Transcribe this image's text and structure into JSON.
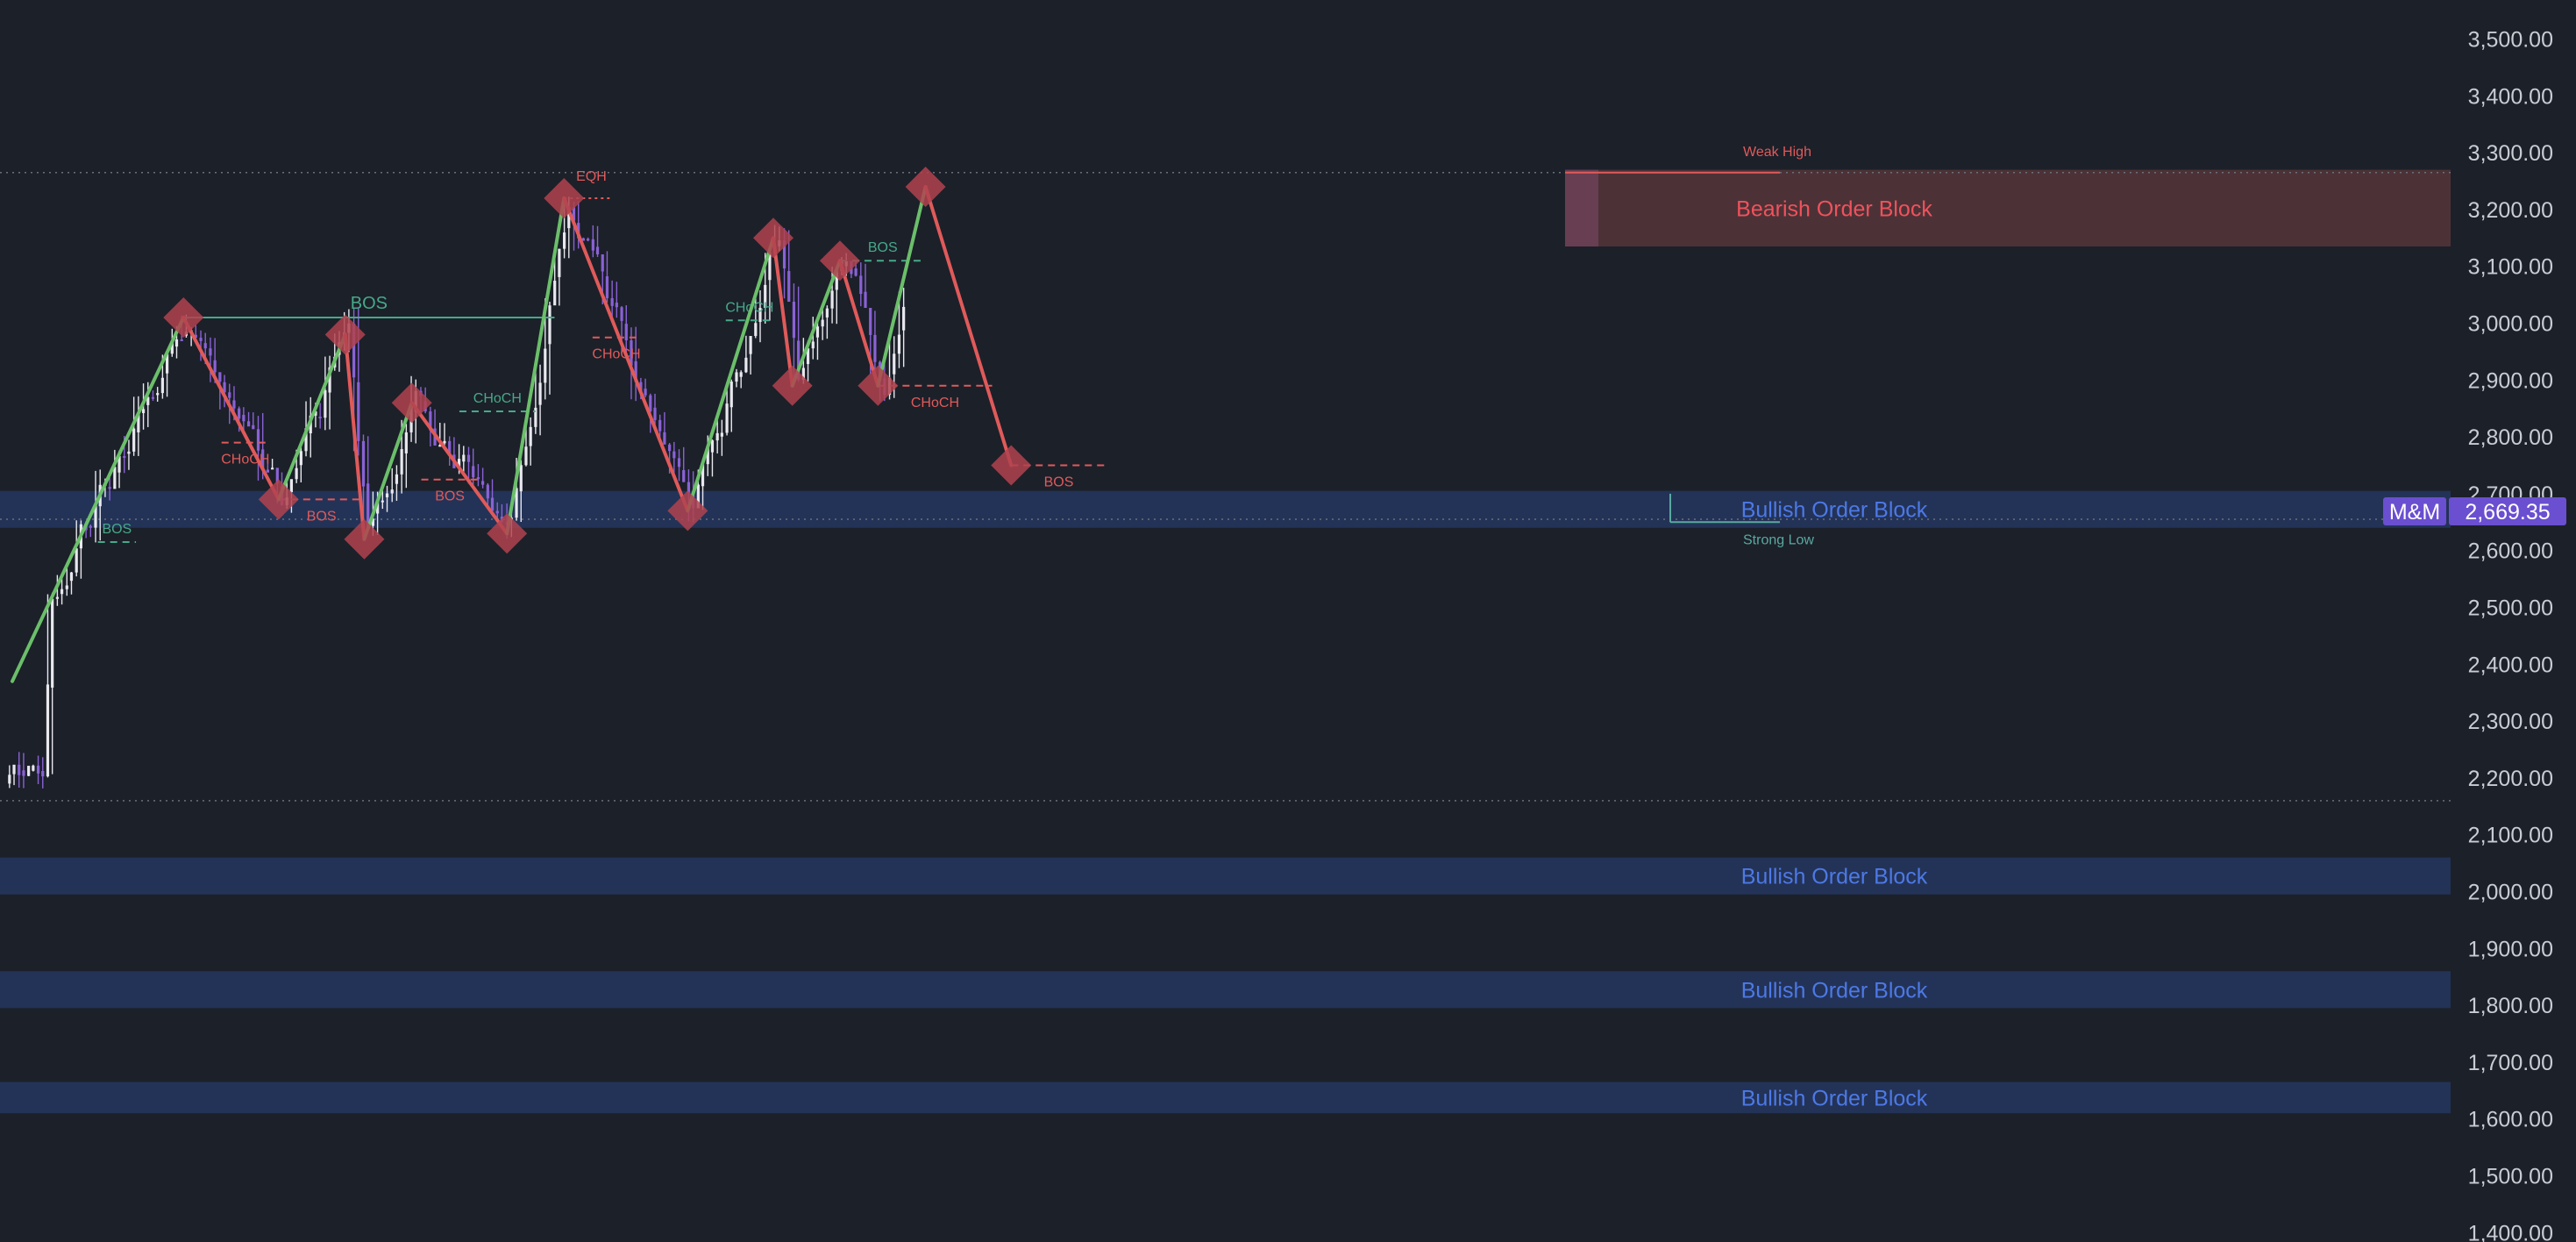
{
  "chart_data": {
    "type": "candlestick",
    "title": "",
    "ylim": [
      1400,
      3560
    ],
    "y_ticks": [
      "3,500.00",
      "3,400.00",
      "3,300.00",
      "3,200.00",
      "3,100.00",
      "3,000.00",
      "2,900.00",
      "2,800.00",
      "2,700.00",
      "2,600.00",
      "2,500.00",
      "2,400.00",
      "2,300.00",
      "2,200.00",
      "2,100.00",
      "2,000.00",
      "1,900.00",
      "1,800.00",
      "1,700.00",
      "1,600.00",
      "1,500.00",
      "1,400.00"
    ],
    "tick_values": [
      3500,
      3400,
      3300,
      3200,
      3100,
      3000,
      2900,
      2800,
      2700,
      2600,
      2500,
      2400,
      2300,
      2200,
      2100,
      2000,
      1900,
      1800,
      1700,
      1600,
      1500,
      1400
    ],
    "x_ticks": [],
    "grid": false,
    "legend": "none",
    "bars": 178,
    "last_price": 2669.35,
    "last_price_label": "2,669.35",
    "tag_label": "M&M",
    "colors": {
      "background": "#1c2029",
      "up_candle": "#e8e8ee",
      "down_candle": "#8a62d6",
      "bullish_line": "#6bbf6a",
      "bearish_line": "#e05a5a",
      "pivot_diamond": "#b0434f",
      "bos_bull": "#46a98a",
      "bos_bear": "#e05a5a",
      "order_block_bull": "#25355c",
      "order_block_bull_text": "#4d79e6",
      "order_block_bear": "#4f3438",
      "order_block_bear_text": "#f0525c",
      "price_tag": "#6a4fd0"
    },
    "zigzag": [
      {
        "i": 0,
        "price": 2370
      },
      {
        "i": 18,
        "price": 3010
      },
      {
        "i": 28,
        "price": 2690
      },
      {
        "i": 35,
        "price": 2980
      },
      {
        "i": 37,
        "price": 2620
      },
      {
        "i": 42,
        "price": 2860
      },
      {
        "i": 52,
        "price": 2630
      },
      {
        "i": 58,
        "price": 3220
      },
      {
        "i": 71,
        "price": 2670
      },
      {
        "i": 80,
        "price": 3150
      },
      {
        "i": 82,
        "price": 2890
      },
      {
        "i": 87,
        "price": 3110
      },
      {
        "i": 91,
        "price": 2890
      },
      {
        "i": 96,
        "price": 3240
      },
      {
        "i": 105,
        "price": 2750
      }
    ],
    "structure_labels": [
      {
        "text": "BOS",
        "i1": 18,
        "i2": 57,
        "price": 3010,
        "side": "bull",
        "size": "md"
      },
      {
        "text": "BOS",
        "i1": 9,
        "i2": 13,
        "price": 2615,
        "side": "bull",
        "size": "sm"
      },
      {
        "text": "CHoCH",
        "i1": 22,
        "i2": 27,
        "price": 2790,
        "side": "bear",
        "size": "sm"
      },
      {
        "text": "BOS",
        "i1": 28,
        "i2": 37,
        "price": 2690,
        "side": "bear",
        "size": "sm"
      },
      {
        "text": "BOS",
        "i1": 43,
        "i2": 49,
        "price": 2725,
        "side": "bear",
        "size": "sm"
      },
      {
        "text": "CHoCH",
        "i1": 47,
        "i2": 55,
        "price": 2845,
        "side": "bull",
        "size": "sm"
      },
      {
        "text": "CHoCH",
        "i1": 61,
        "i2": 66,
        "price": 2975,
        "side": "bear",
        "size": "sm"
      },
      {
        "text": "CHoCH",
        "i1": 75,
        "i2": 80,
        "price": 3005,
        "side": "bull",
        "size": "sm"
      },
      {
        "text": "BOS",
        "i1": 87,
        "i2": 96,
        "price": 3110,
        "side": "bull",
        "size": "sm"
      },
      {
        "text": "CHoCH",
        "i1": 91,
        "i2": 103,
        "price": 2890,
        "side": "bear",
        "size": "sm"
      },
      {
        "text": "BOS",
        "i1": 105,
        "i2": 115,
        "price": 2750,
        "side": "bear",
        "size": "sm"
      }
    ],
    "eqh": {
      "text": "EQH",
      "i1": 58,
      "i2": 63,
      "price": 3220
    },
    "order_blocks": [
      {
        "label": "Bearish Order Block",
        "low": 3135,
        "high": 3270,
        "side": "bear",
        "from_i": 110
      },
      {
        "label": "Bullish Order Block",
        "low": 2640,
        "high": 2705,
        "side": "bull",
        "from_i": 0
      },
      {
        "label": "Bullish Order Block",
        "low": 1995,
        "high": 2060,
        "side": "bull",
        "from_i": 0
      },
      {
        "label": "Bullish Order Block",
        "low": 1795,
        "high": 1860,
        "side": "bull",
        "from_i": 0
      },
      {
        "label": "Bullish Order Block",
        "low": 1610,
        "high": 1665,
        "side": "bull",
        "from_i": 0
      }
    ],
    "swing_levels": [
      {
        "label": "Weak High",
        "price": 3265,
        "side": "bear"
      },
      {
        "label": "Strong Low",
        "price": 2650,
        "side": "bull"
      }
    ],
    "dotted_levels": [
      3265,
      2655,
      2160
    ]
  }
}
